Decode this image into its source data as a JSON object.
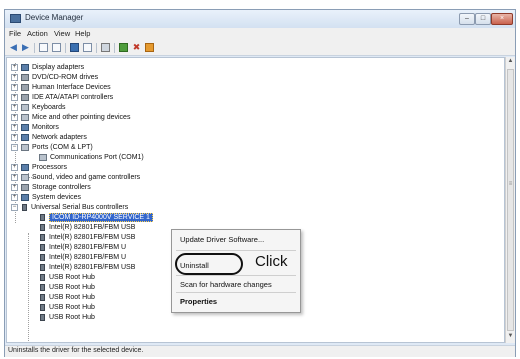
{
  "window": {
    "title": "Device Manager"
  },
  "menu": {
    "file": "File",
    "action": "Action",
    "view": "View",
    "help": "Help"
  },
  "tree": {
    "categories": [
      {
        "label": "Display adapters",
        "expander": "+"
      },
      {
        "label": "DVD/CD-ROM drives",
        "expander": "+"
      },
      {
        "label": "Human Interface Devices",
        "expander": "+"
      },
      {
        "label": "IDE ATA/ATAPI controllers",
        "expander": "+"
      },
      {
        "label": "Keyboards",
        "expander": "+"
      },
      {
        "label": "Mice and other pointing devices",
        "expander": "+"
      },
      {
        "label": "Monitors",
        "expander": "+"
      },
      {
        "label": "Network adapters",
        "expander": "+"
      },
      {
        "label": "Ports (COM & LPT)",
        "expander": "−"
      },
      {
        "label": "Communications Port (COM1)",
        "expander": ""
      },
      {
        "label": "Processors",
        "expander": "+"
      },
      {
        "label": "Sound, video and game controllers",
        "expander": "+"
      },
      {
        "label": "Storage controllers",
        "expander": "+"
      },
      {
        "label": "System devices",
        "expander": "+"
      },
      {
        "label": "Universal Serial Bus controllers",
        "expander": "−"
      }
    ],
    "usb_devices": [
      "ICOM ID-RP4000V SERVICE 1",
      "Intel(R) 82801FB/FBM USB",
      "Intel(R) 82801FB/FBM USB",
      "Intel(R) 82801FB/FBM U",
      "Intel(R) 82801FB/FBM U",
      "Intel(R) 82801FB/FBM USB",
      "USB Root Hub",
      "USB Root Hub",
      "USB Root Hub",
      "USB Root Hub",
      "USB Root Hub"
    ]
  },
  "context_menu": {
    "update_driver": "Update Driver Software...",
    "uninstall": "Uninstall",
    "scan": "Scan for hardware changes",
    "properties": "Properties"
  },
  "annotation": {
    "click": "Click"
  },
  "status": {
    "text": "Uninstalls the driver for the selected device."
  },
  "colors": {
    "selection": "#3366cc",
    "accent": "#3a6fb0"
  }
}
